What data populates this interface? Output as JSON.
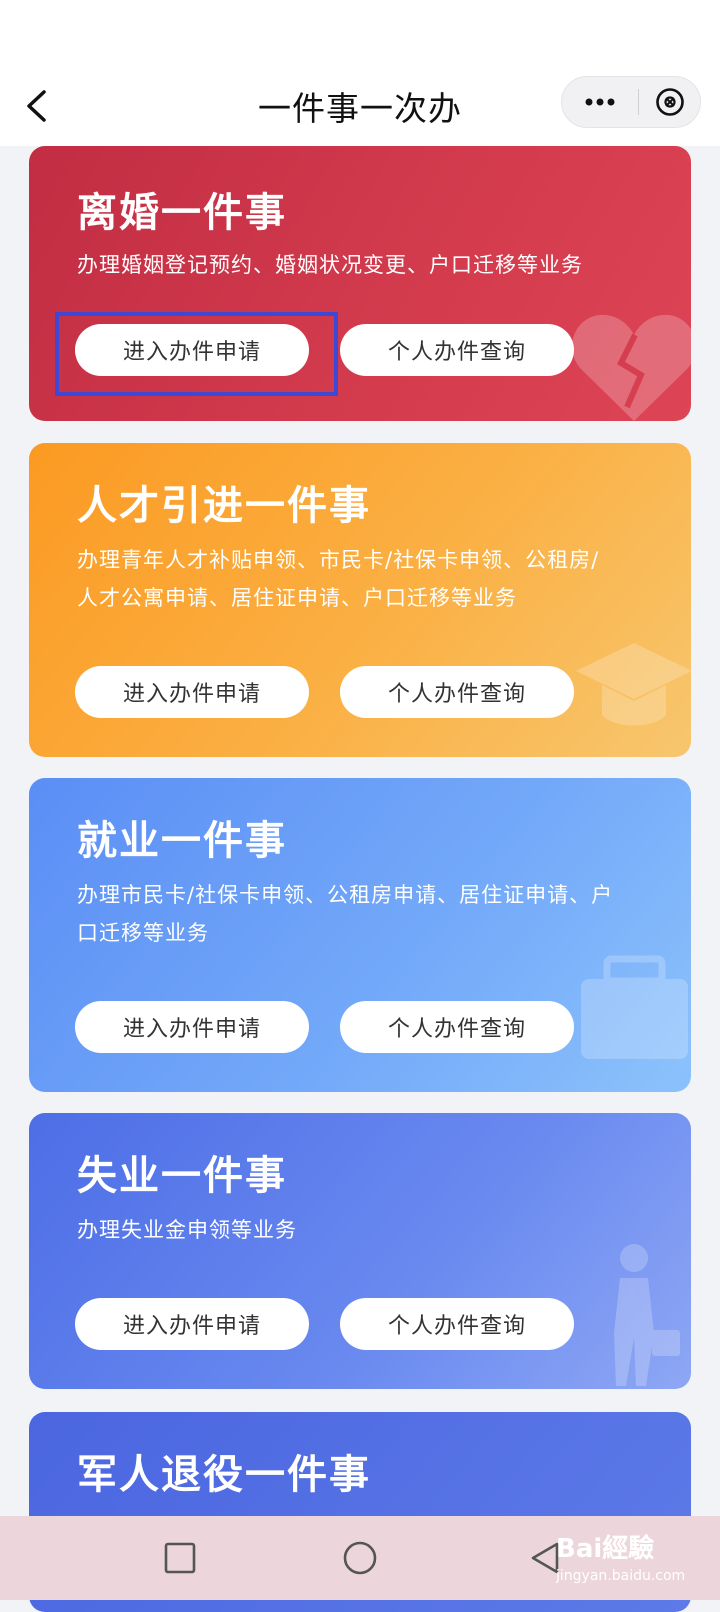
{
  "navbar": {
    "title": "一件事一次办"
  },
  "icons": {
    "back": "back-arrow-icon",
    "more": "more-dots-icon",
    "close": "close-circle-icon"
  },
  "cards": [
    {
      "title": "离婚一件事",
      "desc_lines": [
        "办理婚姻登记预约、婚姻状况变更、户口迁移等业务"
      ],
      "apply_label": "进入办件申请",
      "query_label": "个人办件查询",
      "color": "#c8324a",
      "decoration": "broken-heart-icon"
    },
    {
      "title": "人才引进一件事",
      "desc_lines": [
        "办理青年人才补贴申领、市民卡/社保卡申领、公租房/",
        "人才公寓申请、居住证申请、户口迁移等业务"
      ],
      "apply_label": "进入办件申请",
      "query_label": "个人办件查询",
      "color": "#fba432",
      "decoration": "graduation-cap-icon"
    },
    {
      "title": "就业一件事",
      "desc_lines": [
        "办理市民卡/社保卡申领、公租房申请、居住证申请、户",
        "口迁移等业务"
      ],
      "apply_label": "进入办件申请",
      "query_label": "个人办件查询",
      "color": "#6aa0f7",
      "decoration": "briefcase-icon"
    },
    {
      "title": "失业一件事",
      "desc_lines": [
        "办理失业金申领等业务"
      ],
      "apply_label": "进入办件申请",
      "query_label": "个人办件查询",
      "color": "#5b7dec",
      "decoration": "person-walking-icon"
    },
    {
      "title": "军人退役一件事"
    }
  ],
  "watermark": {
    "logo": "Bai經驗",
    "sub": "jingyan.baidu.com"
  },
  "system_nav": {
    "recent": "square-icon",
    "home": "circle-icon",
    "back": "triangle-back-icon"
  }
}
